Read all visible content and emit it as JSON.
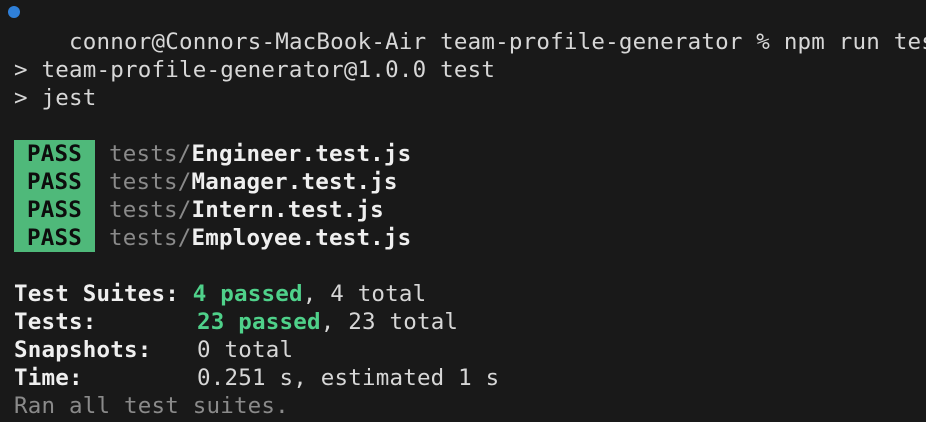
{
  "prompt": {
    "user_host_dir": "connor@Connors-MacBook-Air team-profile-generator %",
    "command": "npm run test"
  },
  "script_lines": [
    "> team-profile-generator@1.0.0 test",
    "> jest"
  ],
  "results": [
    {
      "status": "PASS",
      "dir": "tests/",
      "file": "Engineer.test.js"
    },
    {
      "status": "PASS",
      "dir": "tests/",
      "file": "Manager.test.js"
    },
    {
      "status": "PASS",
      "dir": "tests/",
      "file": "Intern.test.js"
    },
    {
      "status": "PASS",
      "dir": "tests/",
      "file": "Employee.test.js"
    }
  ],
  "summary": {
    "suites_label": "Test Suites:",
    "suites_passed": "4 passed",
    "suites_total": ", 4 total",
    "tests_label": "Tests:",
    "tests_passed": "23 passed",
    "tests_total": ", 23 total",
    "snapshots_label": "Snapshots:",
    "snapshots_value": "0 total",
    "time_label": "Time:",
    "time_value": "0.251 s, estimated 1 s",
    "footer": "Ran all test suites."
  },
  "colors": {
    "background": "#191919",
    "pass_badge": "#4fb97a",
    "passed_text": "#4fd18a",
    "prompt_dot": "#2f80d9"
  }
}
